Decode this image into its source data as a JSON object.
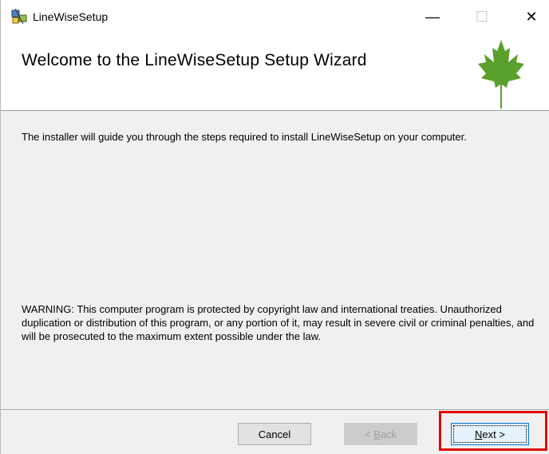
{
  "window": {
    "title": "LineWiseSetup",
    "controls": {
      "minimize": "—",
      "maximize": "☐",
      "close": "✕"
    }
  },
  "banner": {
    "title": "Welcome to the LineWiseSetup Setup Wizard",
    "logo_icon": "maple-leaf-icon",
    "logo_color": "#5aa02c"
  },
  "body": {
    "intro": "The installer will guide you through the steps required to install LineWiseSetup on your computer.",
    "warning": "WARNING: This computer program is protected by copyright law and international treaties. Unauthorized duplication or distribution of this program, or any portion of it, may result in severe civil or criminal penalties, and will be prosecuted to the maximum extent possible under the law."
  },
  "buttons": {
    "cancel": "Cancel",
    "back_prefix": "< ",
    "back_mnemonic": "B",
    "back_rest": "ack",
    "next_mnemonic": "N",
    "next_rest": "ext >"
  },
  "colors": {
    "highlight": "#e00000",
    "focus_border": "#0078d7"
  }
}
